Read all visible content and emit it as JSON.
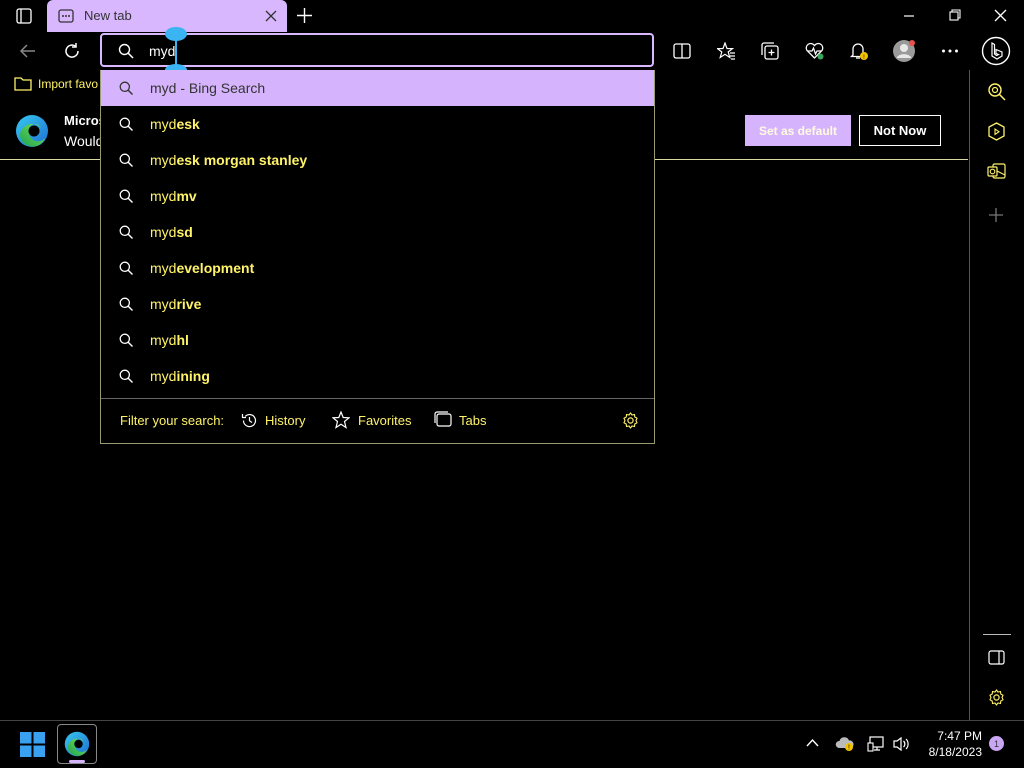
{
  "window": {
    "tab_title": "New tab"
  },
  "address_bar": {
    "value": "myd"
  },
  "favorites_bar": {
    "import_label": "Import favo"
  },
  "notification": {
    "title": "Micros",
    "message": "Would",
    "set_default_label": "Set as default",
    "not_now_label": "Not Now"
  },
  "suggestions": {
    "bing": {
      "typed": "myd",
      "suffix": " - Bing Search"
    },
    "items": [
      {
        "prefix": "myd",
        "completion": "esk"
      },
      {
        "prefix": "myd",
        "completion": "esk morgan stanley"
      },
      {
        "prefix": "myd",
        "completion": "mv"
      },
      {
        "prefix": "myd",
        "completion": "sd"
      },
      {
        "prefix": "myd",
        "completion": "evelopment"
      },
      {
        "prefix": "myd",
        "completion": "rive"
      },
      {
        "prefix": "myd",
        "completion": "hl"
      },
      {
        "prefix": "myd",
        "completion": "ining"
      }
    ]
  },
  "filter": {
    "label": "Filter your search:",
    "history": "History",
    "favorites": "Favorites",
    "tabs": "Tabs"
  },
  "taskbar": {
    "time": "7:47 PM",
    "date": "8/18/2023",
    "notification_count": "1"
  },
  "colors": {
    "accent": "#d6b4fd",
    "highlight_text": "#fff36a",
    "background": "#000000"
  }
}
